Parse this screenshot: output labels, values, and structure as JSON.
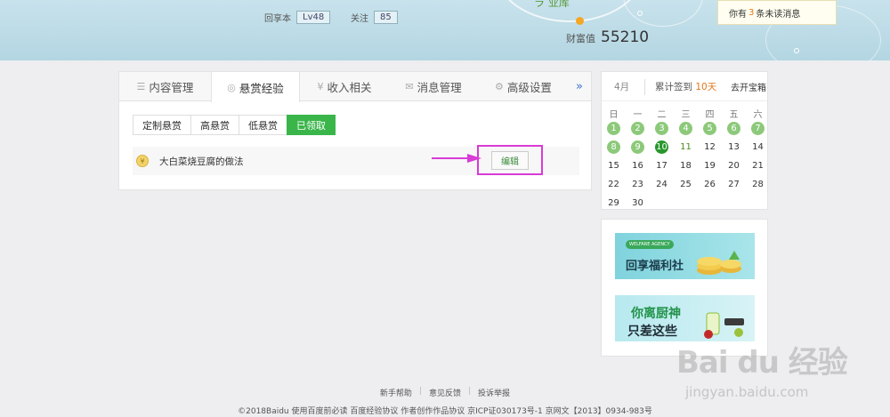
{
  "header": {
    "top_glyph": "ラ 业库",
    "stats": [
      {
        "label": "回享本",
        "value": "Lv48"
      },
      {
        "label": "关注",
        "value": "85"
      }
    ],
    "wealth_label": "财富值",
    "wealth_value": "55210",
    "message": {
      "prefix": "你有",
      "count": "3",
      "suffix": "条未读消息"
    }
  },
  "tabs": [
    {
      "label": "内容管理",
      "icon": "list-icon"
    },
    {
      "label": "悬赏经验",
      "icon": "coin-icon"
    },
    {
      "label": "收入相关",
      "icon": "yen-icon"
    },
    {
      "label": "消息管理",
      "icon": "mail-icon"
    },
    {
      "label": "高级设置",
      "icon": "gear-icon"
    }
  ],
  "more_label": "»",
  "subtabs": [
    "定制悬赏",
    "高悬赏",
    "低悬赏",
    "已领取"
  ],
  "active_subtab_index": 3,
  "item": {
    "title": "大白菜烧豆腐的做法",
    "edit_label": "编辑"
  },
  "calendar": {
    "month": "4月",
    "sign_prefix": "累计签到",
    "sign_days": "10天",
    "treasure": "去开宝箱",
    "weekdays": [
      "日",
      "一",
      "二",
      "三",
      "四",
      "五",
      "六"
    ],
    "rows": [
      [
        "1",
        "2",
        "3",
        "4",
        "5",
        "6",
        "7"
      ],
      [
        "8",
        "9",
        "10",
        "11",
        "12",
        "13",
        "14"
      ],
      [
        "15",
        "16",
        "17",
        "18",
        "19",
        "20",
        "21"
      ],
      [
        "22",
        "23",
        "24",
        "25",
        "26",
        "27",
        "28"
      ],
      [
        "29",
        "30",
        "",
        "",
        "",
        "",
        ""
      ]
    ],
    "signed_days": [
      "1",
      "2",
      "3",
      "4",
      "5",
      "6",
      "7",
      "8",
      "9"
    ],
    "today": "10",
    "highlight_days": [
      "11"
    ]
  },
  "ads": [
    {
      "tag": "WELFARE AGENCY",
      "text": "回享福利社"
    },
    {
      "line1": "你离厨神",
      "line2": "只差这些"
    }
  ],
  "footer": {
    "links": [
      "新手帮助",
      "意见反馈",
      "投诉举报"
    ],
    "copyright": "©2018Baidu  使用百度前必读  百度经验协议  作者创作作品协议  京ICP证030173号-1 京网文【2013】0934-983号"
  },
  "watermark": {
    "main": "Bai du 经验",
    "sub": "jingyan.baidu.com"
  }
}
